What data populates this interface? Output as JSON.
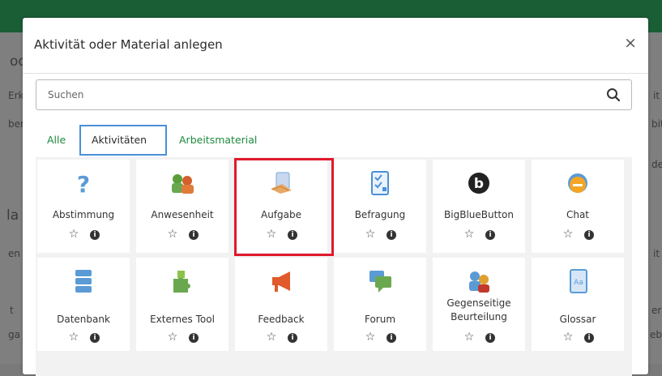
{
  "modal": {
    "title": "Aktivität oder Material anlegen",
    "close_glyph": "×"
  },
  "search": {
    "placeholder": "Suchen",
    "value": "",
    "icon": "search-icon"
  },
  "tabs": [
    {
      "label": "Alle",
      "active": false
    },
    {
      "label": "Aktivitäten",
      "active": true
    },
    {
      "label": "Arbeitsmaterial",
      "active": false
    }
  ],
  "tiles": [
    {
      "name": "Abstimmung",
      "icon": "question-icon",
      "color": "#5b9bd5"
    },
    {
      "name": "Anwesenheit",
      "icon": "attendance-icon",
      "color": "#6aa84f"
    },
    {
      "name": "Aufgabe",
      "icon": "assignment-icon",
      "color": "#7ba7d9"
    },
    {
      "name": "Befragung",
      "icon": "checklist-icon",
      "color": "#4a90d9"
    },
    {
      "name": "BigBlueButton",
      "icon": "bigbluebutton-icon",
      "color": "#222222"
    },
    {
      "name": "Chat",
      "icon": "chat-bubble-icon",
      "color": "#f5a623"
    },
    {
      "name": "Datenbank",
      "icon": "database-icon",
      "color": "#5b9bd5"
    },
    {
      "name": "Externes Tool",
      "icon": "puzzle-icon",
      "color": "#6aa84f"
    },
    {
      "name": "Feedback",
      "icon": "megaphone-icon",
      "color": "#e05a2b"
    },
    {
      "name": "Forum",
      "icon": "forum-icon",
      "color": "#6aa84f"
    },
    {
      "name": "Gegenseitige Beurteilung",
      "icon": "peer-review-icon",
      "color": "#e0a030"
    },
    {
      "name": "Glossar",
      "icon": "glossary-icon",
      "color": "#5b9bd5"
    }
  ],
  "tile_actions": {
    "star_glyph": "☆",
    "info_glyph": "i"
  },
  "background_fragments": [
    "oo",
    "Erk",
    "ber",
    "la",
    "en",
    "t",
    "ga",
    "de",
    "it",
    "bit",
    "it",
    "er",
    "ebt"
  ],
  "colors": {
    "topbar": "#1a5e36",
    "tab_link": "#1d8a3c",
    "active_tab_border": "#4a90d9",
    "highlight": "#e0192b"
  }
}
